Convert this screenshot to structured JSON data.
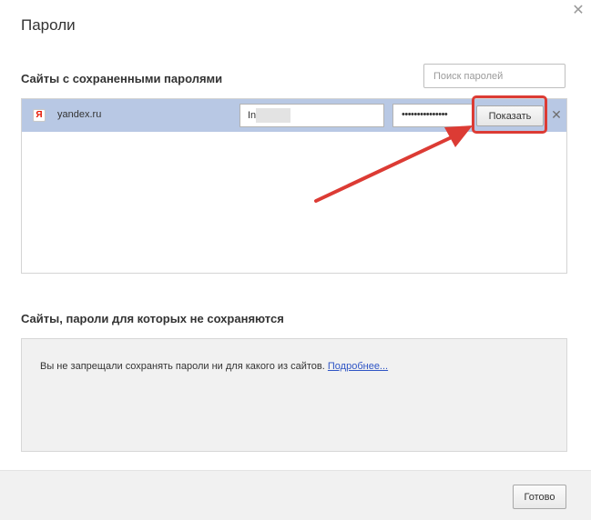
{
  "dialog": {
    "title": "Пароли",
    "close_icon": "close-icon"
  },
  "saved": {
    "heading": "Сайты с сохраненными паролями",
    "search_placeholder": "Поиск паролей",
    "rows": [
      {
        "favicon_letter": "Я",
        "favicon_color": "#e61400",
        "site": "yandex.ru",
        "login": "In",
        "password_mask": "•••••••••••••••",
        "show_label": "Показать",
        "remove_icon": "remove-icon"
      }
    ]
  },
  "excluded": {
    "heading": "Сайты, пароли для которых не сохраняются",
    "message": "Вы не запрещали сохранять пароли ни для какого из сайтов.",
    "link": "Подробнее..."
  },
  "footer": {
    "done_label": "Готово"
  },
  "annotation": {
    "color": "#dc3b34"
  }
}
